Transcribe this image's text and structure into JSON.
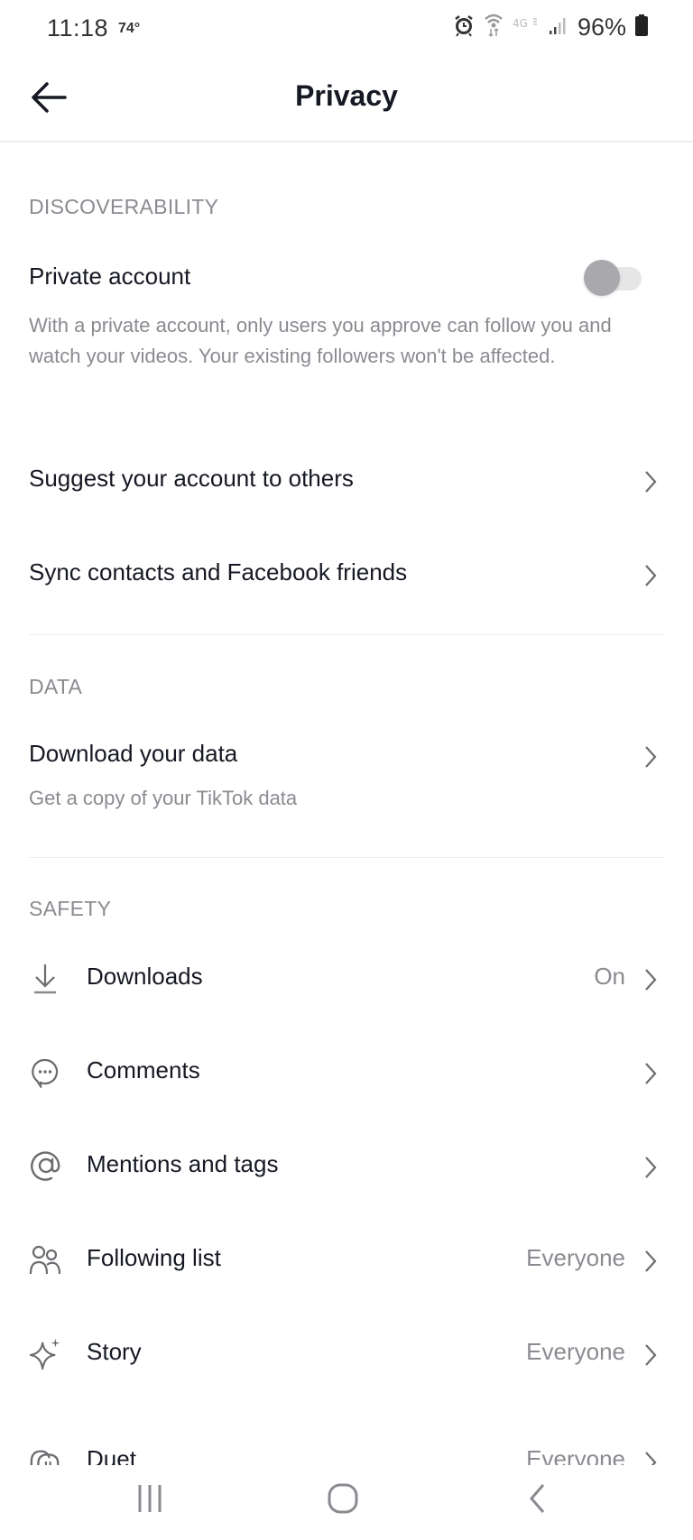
{
  "status_bar": {
    "time": "11:18",
    "temperature": "74°",
    "network": "4G",
    "battery_percent": "96%",
    "icons": [
      "alarm-icon",
      "wifi-data-icon",
      "4g-icon",
      "signal-icon",
      "battery-icon"
    ]
  },
  "header": {
    "back_icon": "arrow-left-icon",
    "title": "Privacy"
  },
  "sections": {
    "discoverability": {
      "label": "DISCOVERABILITY",
      "private_account": {
        "title": "Private account",
        "description": "With a private account, only users you approve can follow you and watch your videos. Your existing followers won't be affected.",
        "toggle_on": false
      },
      "suggest": {
        "title": "Suggest your account to others"
      },
      "sync": {
        "title": "Sync contacts and Facebook friends"
      }
    },
    "data": {
      "label": "DATA",
      "download": {
        "title": "Download your data",
        "subtitle": "Get a copy of your TikTok data"
      }
    },
    "safety": {
      "label": "SAFETY",
      "items": [
        {
          "icon": "download-icon",
          "title": "Downloads",
          "value": "On"
        },
        {
          "icon": "comment-icon",
          "title": "Comments",
          "value": ""
        },
        {
          "icon": "at-sign-icon",
          "title": "Mentions and tags",
          "value": ""
        },
        {
          "icon": "people-icon",
          "title": "Following list",
          "value": "Everyone"
        },
        {
          "icon": "sparkle-icon",
          "title": "Story",
          "value": "Everyone"
        },
        {
          "icon": "duet-icon",
          "title": "Duet",
          "value": "Everyone"
        }
      ]
    }
  },
  "system_nav": {
    "recents": "recent-apps-icon",
    "home": "home-icon",
    "back": "back-icon"
  },
  "colors": {
    "primary_text": "#161823",
    "secondary_text": "#8a8b91",
    "divider": "#ececec",
    "toggle_off_knob": "#a8a8ad",
    "toggle_off_track": "#e6e6e6"
  }
}
